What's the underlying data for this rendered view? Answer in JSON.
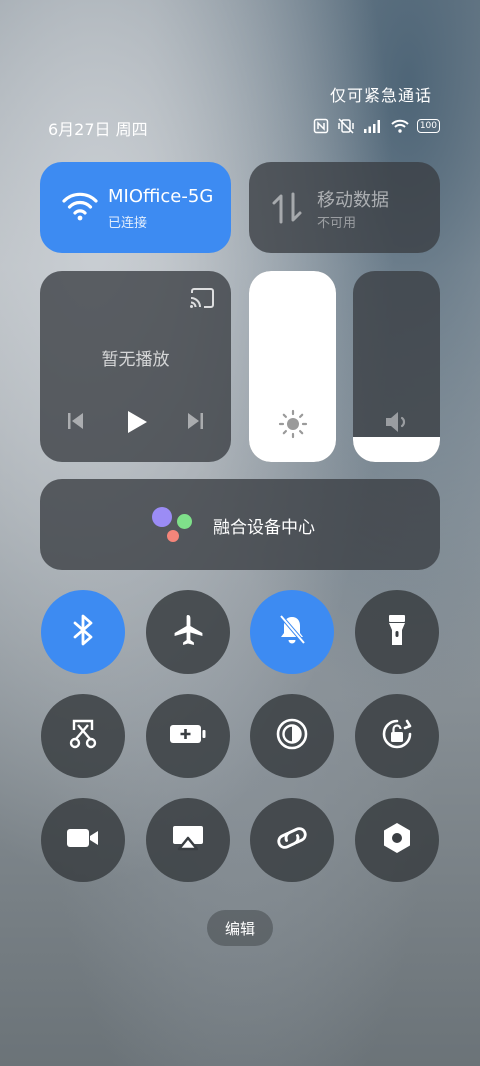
{
  "status_bar": {
    "emergency_text": "仅可紧急通话",
    "date": "6月27日 周四",
    "battery": "100",
    "icons": [
      "nfc-icon",
      "vibrate-off-icon",
      "signal-icon",
      "wifi-icon",
      "battery-icon"
    ]
  },
  "tiles": {
    "wifi": {
      "title": "MIOffice-5G",
      "subtitle": "已连接",
      "icon": "wifi-icon",
      "active": true
    },
    "mobile_data": {
      "title": "移动数据",
      "subtitle": "不可用",
      "icon": "mobile-data-icon",
      "active": false
    }
  },
  "media": {
    "text": "暂无播放",
    "icons": [
      "cast-icon",
      "previous-icon",
      "play-icon",
      "next-icon"
    ]
  },
  "sliders": {
    "brightness": {
      "icon": "sun-icon",
      "level": 1.0
    },
    "volume": {
      "icon": "speaker-icon",
      "level": 0.13
    }
  },
  "fusion": {
    "label": "融合设备中心",
    "colors": [
      "#9b8cf5",
      "#7fe08a",
      "#f5857a"
    ]
  },
  "toggles": [
    {
      "name": "bluetooth",
      "icon": "bluetooth-icon",
      "active": true
    },
    {
      "name": "airplane",
      "icon": "airplane-icon",
      "active": false
    },
    {
      "name": "silent",
      "icon": "bell-off-icon",
      "active": true
    },
    {
      "name": "flashlight",
      "icon": "flashlight-icon",
      "active": false
    },
    {
      "name": "screenshot",
      "icon": "scissors-icon",
      "active": false
    },
    {
      "name": "battery-saver",
      "icon": "battery-plus-icon",
      "active": false
    },
    {
      "name": "dark-mode",
      "icon": "contrast-icon",
      "active": false
    },
    {
      "name": "rotation-lock",
      "icon": "rotation-lock-icon",
      "active": false
    },
    {
      "name": "screen-record",
      "icon": "video-camera-icon",
      "active": false
    },
    {
      "name": "screen-cast",
      "icon": "airplay-icon",
      "active": false
    },
    {
      "name": "link",
      "icon": "link-icon",
      "active": false
    },
    {
      "name": "settings",
      "icon": "hexagon-icon",
      "active": false
    }
  ],
  "colors": {
    "accent": "#3d8bf2",
    "tile_bg": "#3a3e42"
  },
  "edit_label": "编辑"
}
